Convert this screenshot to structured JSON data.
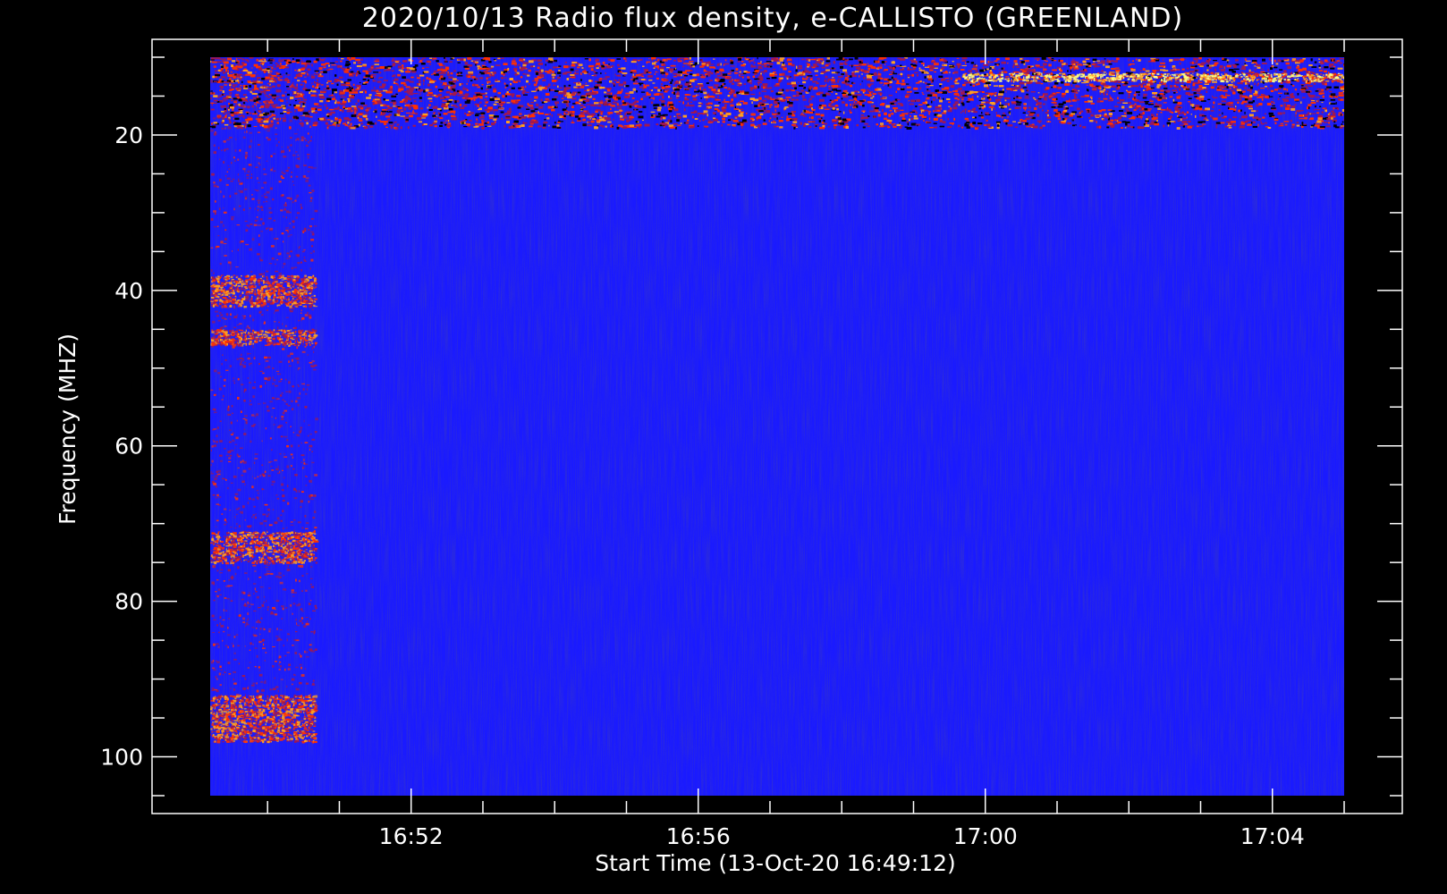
{
  "chart_data": {
    "type": "heatmap",
    "title": "2020/10/13  Radio flux density, e-CALLISTO (GREENLAND)",
    "xlabel": "Start Time (13-Oct-20 16:49:12)",
    "ylabel": "Frequency (MHZ)",
    "x_unit": "time (HH:MM)",
    "y_unit": "MHz",
    "xlim": [
      "16:49:12",
      "17:05:00"
    ],
    "ylim": [
      10,
      105
    ],
    "y_inverted": true,
    "x_tick_labels": [
      "16:52",
      "16:56",
      "17:00",
      "17:04"
    ],
    "y_tick_labels": [
      "20",
      "40",
      "60",
      "80",
      "100"
    ],
    "grid": false,
    "colormap": [
      "#000000",
      "#2a00c8",
      "#2020ff",
      "#a01850",
      "#ff3000",
      "#ffa020",
      "#ffff80"
    ],
    "background_color": "#1a1aff",
    "features": [
      {
        "label": "broadband interference block",
        "time_start": "16:49:12",
        "time_end": "16:50:40",
        "freq_range": [
          10,
          98
        ],
        "intensity": "medium"
      },
      {
        "label": "intense band",
        "time_start": "16:49:12",
        "time_end": "16:50:40",
        "freq_range": [
          38,
          42
        ],
        "intensity": "high"
      },
      {
        "label": "intense band",
        "time_start": "16:49:12",
        "time_end": "16:50:40",
        "freq_range": [
          45,
          47
        ],
        "intensity": "high"
      },
      {
        "label": "intense band",
        "time_start": "16:49:12",
        "time_end": "16:50:40",
        "freq_range": [
          71,
          75
        ],
        "intensity": "high"
      },
      {
        "label": "intense band",
        "time_start": "16:49:12",
        "time_end": "16:50:40",
        "freq_range": [
          92,
          98
        ],
        "intensity": "high"
      },
      {
        "label": "low-frequency interference",
        "time_start": "16:49:12",
        "time_end": "17:05:00",
        "freq_range": [
          10,
          19
        ],
        "intensity": "medium"
      },
      {
        "label": "narrowband emission line",
        "time_start": "16:59:40",
        "time_end": "17:05:00",
        "freq_range": [
          12,
          13
        ],
        "intensity": "very high"
      }
    ]
  }
}
